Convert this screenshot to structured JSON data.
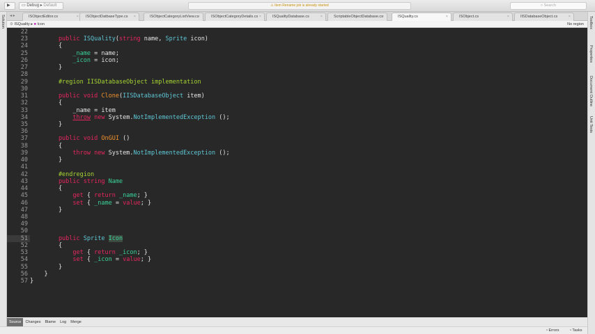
{
  "toolbar": {
    "run_icon": "play-icon",
    "config": "Debug",
    "target": "Default",
    "status_message": "Item Rename job is already started",
    "search_placeholder": "Search"
  },
  "tabs": [
    {
      "label": "ISObjectEditor.cs"
    },
    {
      "label": "ISObjectDatbaseType.cs"
    },
    {
      "label": "ISObjectCategoryListView.cs"
    },
    {
      "label": "ISObjectCategoryDetails.cs"
    },
    {
      "label": "ISQualityDatabase.cs"
    },
    {
      "label": "ScriptableObjectDatabase.cs"
    },
    {
      "label": "ISQuality.cs",
      "active": true
    },
    {
      "label": "ISObject.cs"
    },
    {
      "label": "IISDatabaseObject.cs"
    }
  ],
  "breadcrumb": {
    "class_name": "ISQuality",
    "member": "Icon",
    "region": "No region"
  },
  "left_panel": {
    "label": "Solution"
  },
  "right_panel": [
    "Toolbox",
    "Properties",
    "Document Outline",
    "Unit Tests"
  ],
  "editor": {
    "current_line": 51,
    "lines": [
      {
        "n": 22,
        "t": []
      },
      {
        "n": 23,
        "t": [
          [
            "kw",
            "        public "
          ],
          [
            "ty",
            "ISQuality"
          ],
          [
            "pl",
            "("
          ],
          [
            "kw",
            "string"
          ],
          [
            "pl",
            " name, "
          ],
          [
            "ty",
            "Sprite"
          ],
          [
            "pl",
            " icon)"
          ]
        ]
      },
      {
        "n": 24,
        "t": [
          [
            "pl",
            "        {"
          ]
        ]
      },
      {
        "n": 25,
        "t": [
          [
            "mem",
            "            _name"
          ],
          [
            "pl",
            " = name;"
          ]
        ]
      },
      {
        "n": 26,
        "t": [
          [
            "mem",
            "            _icon"
          ],
          [
            "pl",
            " = icon;"
          ]
        ]
      },
      {
        "n": 27,
        "t": [
          [
            "pl",
            "        }"
          ]
        ]
      },
      {
        "n": 28,
        "t": []
      },
      {
        "n": 29,
        "t": [
          [
            "dir",
            "        #region IISDatabaseObject implementation"
          ]
        ]
      },
      {
        "n": 30,
        "t": []
      },
      {
        "n": 31,
        "t": [
          [
            "kw",
            "        public void "
          ],
          [
            "fn",
            "Clone"
          ],
          [
            "pl",
            "("
          ],
          [
            "ty",
            "IISDatabaseObject"
          ],
          [
            "pl",
            " item)"
          ]
        ]
      },
      {
        "n": 32,
        "t": [
          [
            "pl",
            "        {"
          ]
        ]
      },
      {
        "n": 33,
        "t": [
          [
            "pl",
            "            _name = item"
          ]
        ]
      },
      {
        "n": 34,
        "t": [
          [
            "pl",
            "            "
          ],
          [
            "kw ul",
            "throw"
          ],
          [
            "kw",
            " new "
          ],
          [
            "pl",
            "System."
          ],
          [
            "ty",
            "NotImplementedException"
          ],
          [
            "pl",
            " ();"
          ]
        ]
      },
      {
        "n": 35,
        "t": [
          [
            "pl",
            "        }"
          ]
        ]
      },
      {
        "n": 36,
        "t": []
      },
      {
        "n": 37,
        "t": [
          [
            "kw",
            "        public void "
          ],
          [
            "fn",
            "OnGUI"
          ],
          [
            "pl",
            " ()"
          ]
        ]
      },
      {
        "n": 38,
        "t": [
          [
            "pl",
            "        {"
          ]
        ]
      },
      {
        "n": 39,
        "t": [
          [
            "kw",
            "            throw new "
          ],
          [
            "pl",
            "System."
          ],
          [
            "ty",
            "NotImplementedException"
          ],
          [
            "pl",
            " ();"
          ]
        ]
      },
      {
        "n": 40,
        "t": [
          [
            "pl",
            "        }"
          ]
        ]
      },
      {
        "n": 41,
        "t": []
      },
      {
        "n": 42,
        "t": [
          [
            "dir",
            "        #endregion"
          ]
        ]
      },
      {
        "n": 43,
        "t": [
          [
            "kw",
            "        public string "
          ],
          [
            "mem",
            "Name"
          ]
        ]
      },
      {
        "n": 44,
        "t": [
          [
            "pl",
            "        {"
          ]
        ]
      },
      {
        "n": 45,
        "t": [
          [
            "kw",
            "            get "
          ],
          [
            "pl",
            "{ "
          ],
          [
            "kw",
            "return "
          ],
          [
            "mem",
            "_name"
          ],
          [
            "pl",
            "; }"
          ]
        ]
      },
      {
        "n": 46,
        "t": [
          [
            "kw",
            "            set "
          ],
          [
            "pl",
            "{ "
          ],
          [
            "mem",
            "_name"
          ],
          [
            "pl",
            " = "
          ],
          [
            "kw",
            "value"
          ],
          [
            "pl",
            "; }"
          ]
        ]
      },
      {
        "n": 47,
        "t": [
          [
            "pl",
            "        }"
          ]
        ]
      },
      {
        "n": 48,
        "t": []
      },
      {
        "n": 49,
        "t": []
      },
      {
        "n": 50,
        "t": []
      },
      {
        "n": 51,
        "t": [
          [
            "kw",
            "        public "
          ],
          [
            "ty",
            "Sprite "
          ],
          [
            "mem hl",
            "Icon"
          ]
        ]
      },
      {
        "n": 52,
        "t": [
          [
            "pl",
            "        {"
          ]
        ]
      },
      {
        "n": 53,
        "t": [
          [
            "kw",
            "            get "
          ],
          [
            "pl",
            "{ "
          ],
          [
            "kw",
            "return "
          ],
          [
            "mem",
            "_icon"
          ],
          [
            "pl",
            "; }"
          ]
        ]
      },
      {
        "n": 54,
        "t": [
          [
            "kw",
            "            set "
          ],
          [
            "pl",
            "{ "
          ],
          [
            "mem",
            "_icon"
          ],
          [
            "pl",
            " = "
          ],
          [
            "kw",
            "value"
          ],
          [
            "pl",
            "; }"
          ]
        ]
      },
      {
        "n": 55,
        "t": [
          [
            "pl",
            "        }"
          ]
        ]
      },
      {
        "n": 56,
        "t": [
          [
            "pl",
            "    }"
          ]
        ]
      },
      {
        "n": 57,
        "t": [
          [
            "pl",
            "}"
          ]
        ]
      }
    ]
  },
  "bottom_tabs": [
    {
      "label": "Source",
      "active": true
    },
    {
      "label": "Changes"
    },
    {
      "label": "Blame"
    },
    {
      "label": "Log"
    },
    {
      "label": "Merge"
    }
  ],
  "statusbar": {
    "errors": "Errors",
    "tasks": "Tasks"
  }
}
